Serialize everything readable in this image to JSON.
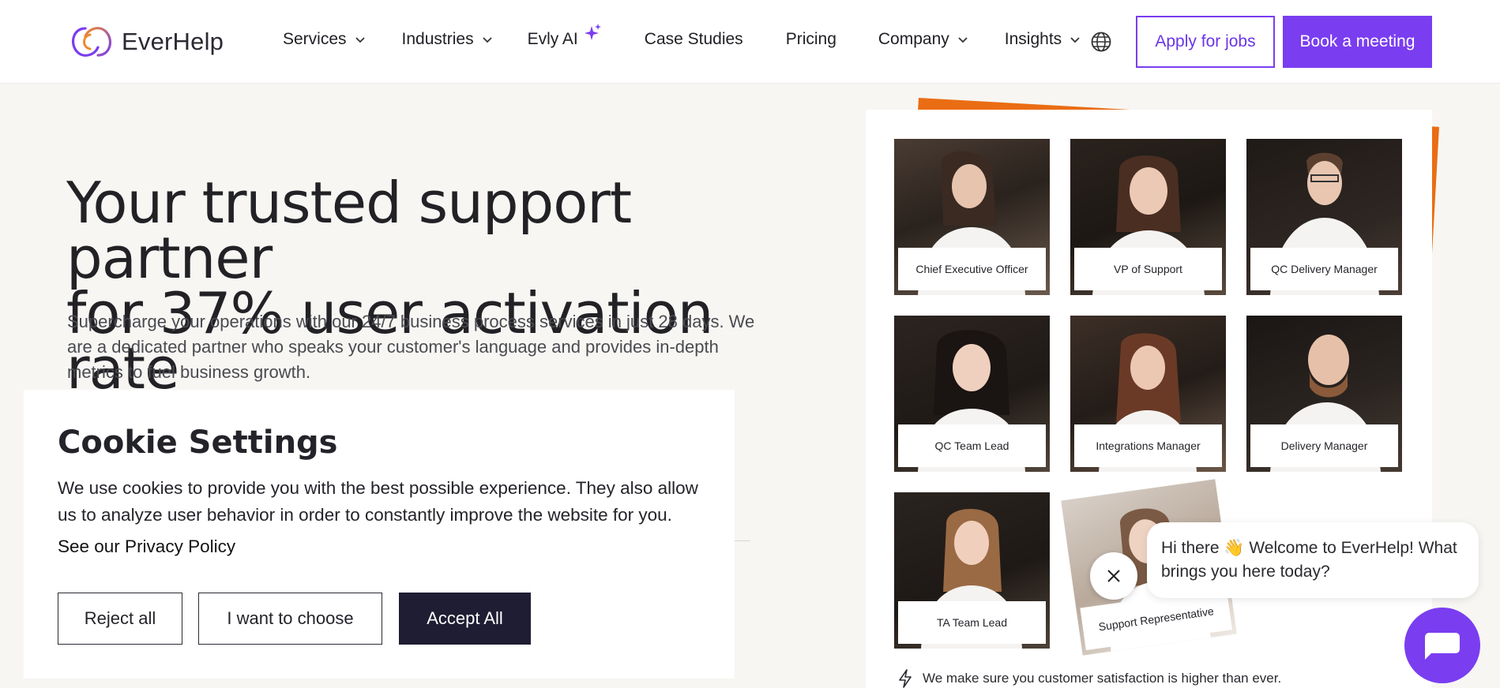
{
  "header": {
    "logo_text": "EverHelp",
    "nav": [
      {
        "label": "Services",
        "dropdown": true
      },
      {
        "label": "Industries",
        "dropdown": true
      },
      {
        "label": "Evly AI",
        "dropdown": false,
        "icon": "sparkle-icon"
      },
      {
        "label": "Case Studies",
        "dropdown": false
      },
      {
        "label": "Pricing",
        "dropdown": false
      },
      {
        "label": "Company",
        "dropdown": true
      },
      {
        "label": "Insights",
        "dropdown": true
      }
    ],
    "apply_label": "Apply for jobs",
    "book_label": "Book a meeting"
  },
  "hero": {
    "title_line1": "Your trusted support partner",
    "title_line2": "for 37% user activation rate",
    "subtitle": "Supercharge your operations with our 24/7 business process services in just 28 days. We are a dedicated partner who speaks your customer's language and provides in-depth metrics to fuel business growth."
  },
  "cookie": {
    "title": "Cookie Settings",
    "text": "We use cookies to provide you with the best possible experience. They also allow us to analyze user behavior in order to constantly improve the website for you.",
    "policy_link": "See our Privacy Policy",
    "reject_label": "Reject all",
    "choose_label": "I want to choose",
    "accept_label": "Accept All"
  },
  "team": {
    "members": [
      "Chief Executive Officer",
      "VP of Support",
      "QC Delivery Manager",
      "QC Team Lead",
      "Integrations Manager",
      "Delivery Manager",
      "TA Team Lead",
      "Support Representative"
    ],
    "satisfaction": "We make sure you customer satisfaction is higher than ever."
  },
  "chat": {
    "message": "Hi there 👋 Welcome to EverHelp! What brings you here today?"
  },
  "colors": {
    "brand_purple": "#7a3df0",
    "accent_orange": "#ea6d14",
    "dark_button": "#1f1d33"
  }
}
